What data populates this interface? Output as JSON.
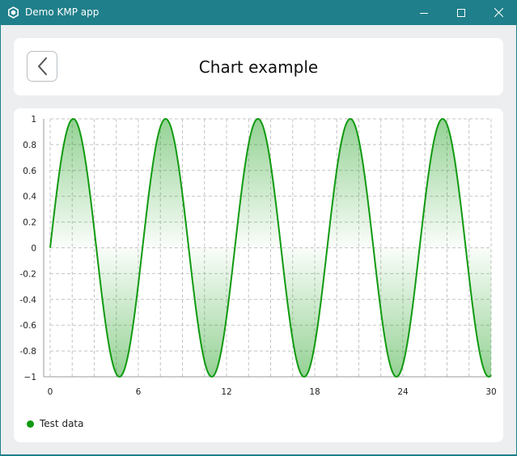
{
  "window": {
    "title": "Demo KMP app"
  },
  "header": {
    "title": "Chart example"
  },
  "icons": {
    "app": "app-logo-icon",
    "minimize": "minimize-icon",
    "maximize": "maximize-icon",
    "close": "close-icon",
    "back": "chevron-left-icon"
  },
  "colors": {
    "titlebar": "#1f7f8a",
    "series": "#119a11"
  },
  "chart_data": {
    "type": "area",
    "xlim": [
      0,
      30
    ],
    "ylim": [
      -1,
      1
    ],
    "x_ticks": [
      0,
      6,
      12,
      18,
      24,
      30
    ],
    "y_ticks": [
      1,
      0.8,
      0.6,
      0.4,
      0.2,
      0,
      -0.2,
      -0.4,
      -0.6,
      -0.8,
      -1
    ],
    "y_tick_labels": [
      "1",
      "0.8",
      "0.6",
      "0.4",
      "0.2",
      "0",
      "-0.2",
      "-0.4",
      "-0.6",
      "-0.8",
      "−1"
    ],
    "grid": true,
    "legend_position": "bottom-left",
    "series": [
      {
        "name": "Test data",
        "function": "sin(x)",
        "x": [
          0,
          1.5708,
          4.7124,
          7.854,
          10.9956,
          14.1372,
          17.2788,
          20.4204,
          23.5619,
          26.7035,
          29.8451,
          30
        ],
        "values": [
          0,
          1,
          -1,
          1,
          -1,
          1,
          -1,
          1,
          -1,
          1,
          -1,
          -0.988
        ]
      }
    ]
  }
}
